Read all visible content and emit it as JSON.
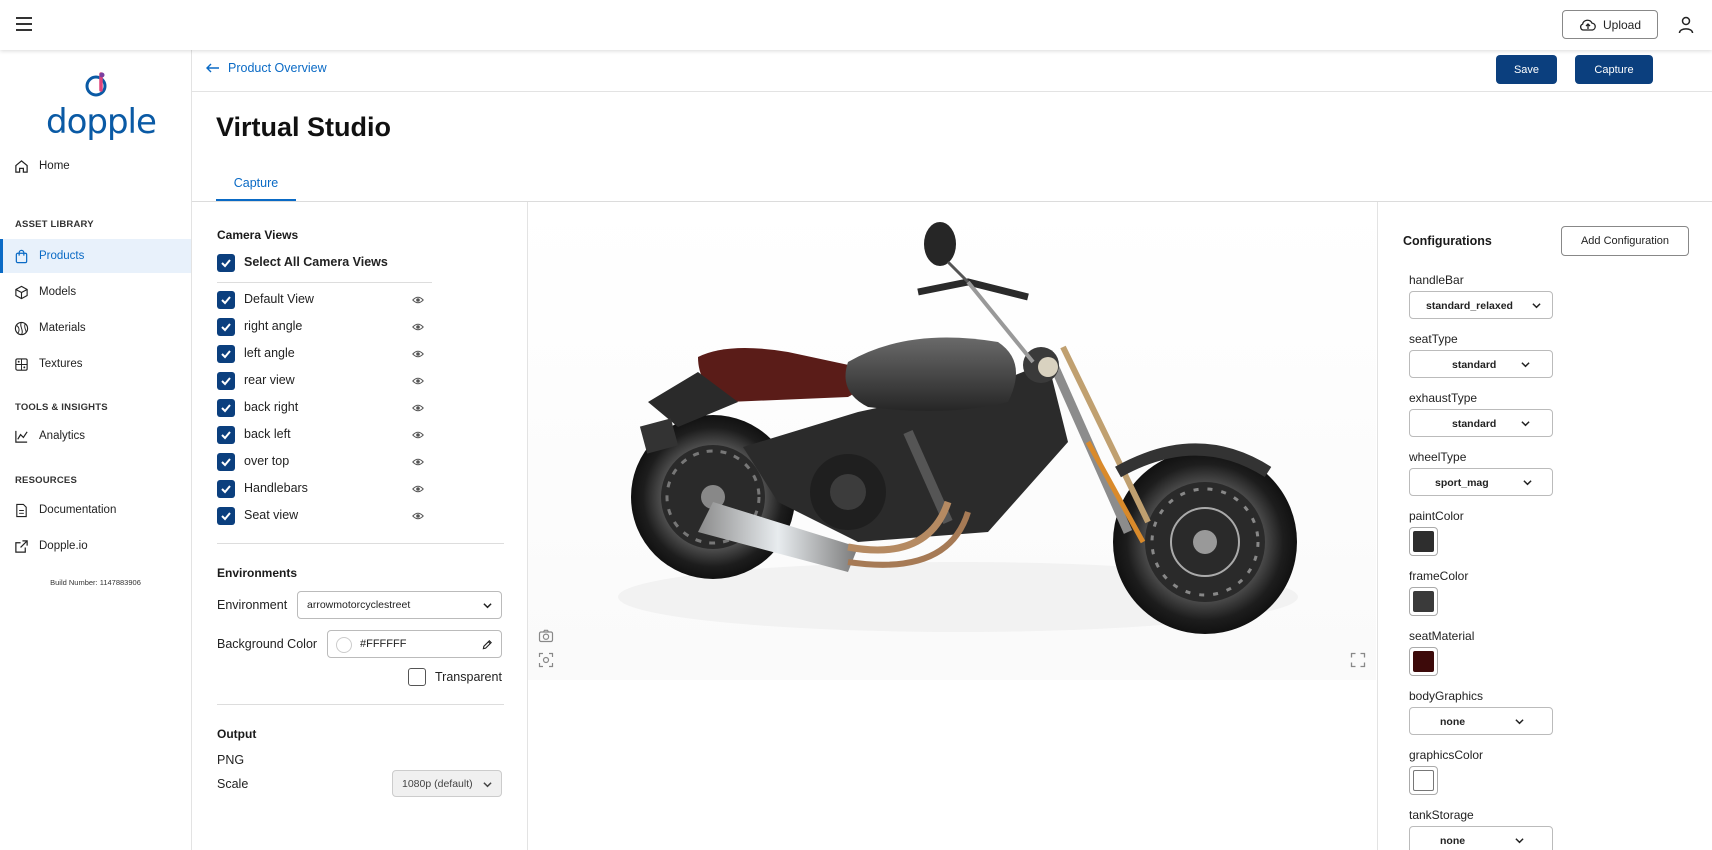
{
  "topbar": {
    "upload_label": "Upload"
  },
  "brand": {
    "logo_text": "dopple"
  },
  "sidebar": {
    "home": "Home",
    "section_asset_library": "ASSET LIBRARY",
    "products": "Products",
    "models": "Models",
    "materials": "Materials",
    "textures": "Textures",
    "section_tools": "TOOLS & INSIGHTS",
    "analytics": "Analytics",
    "section_resources": "RESOURCES",
    "documentation": "Documentation",
    "dopple_io": "Dopple.io",
    "build_number": "Build Number: 1147883906"
  },
  "header": {
    "back_label": "Product Overview",
    "save_label": "Save",
    "capture_label": "Capture",
    "page_title": "Virtual Studio",
    "tab_capture": "Capture"
  },
  "camera_views": {
    "title": "Camera Views",
    "select_all": "Select All Camera Views",
    "items": [
      {
        "label": "Default View",
        "checked": true
      },
      {
        "label": "right angle",
        "checked": true
      },
      {
        "label": "left angle",
        "checked": true
      },
      {
        "label": "rear view",
        "checked": true
      },
      {
        "label": "back right",
        "checked": true
      },
      {
        "label": "back left",
        "checked": true
      },
      {
        "label": "over top",
        "checked": true
      },
      {
        "label": "Handlebars",
        "checked": true
      },
      {
        "label": "Seat view",
        "checked": true
      }
    ]
  },
  "environments": {
    "title": "Environments",
    "environment_label": "Environment",
    "environment_value": "arrowmotorcyclestreet",
    "background_label": "Background Color",
    "background_value": "#FFFFFF",
    "transparent_label": "Transparent",
    "transparent_checked": false
  },
  "output": {
    "title": "Output",
    "format": "PNG",
    "scale_label": "Scale",
    "scale_value": "1080p (default)"
  },
  "configurations": {
    "title": "Configurations",
    "add_label": "Add Configuration",
    "options": [
      {
        "label": "handleBar",
        "type": "select",
        "value": "standard_relaxed"
      },
      {
        "label": "seatType",
        "type": "select",
        "value": "standard"
      },
      {
        "label": "exhaustType",
        "type": "select",
        "value": "standard"
      },
      {
        "label": "wheelType",
        "type": "select",
        "value": "sport_mag"
      },
      {
        "label": "paintColor",
        "type": "color",
        "color": "#2e2e2e"
      },
      {
        "label": "frameColor",
        "type": "color",
        "color": "#3a3a3a"
      },
      {
        "label": "seatMaterial",
        "type": "color",
        "color": "#3d0a0a"
      },
      {
        "label": "bodyGraphics",
        "type": "select",
        "value": "none"
      },
      {
        "label": "graphicsColor",
        "type": "color",
        "color": "#ffffff"
      },
      {
        "label": "tankStorage",
        "type": "select",
        "value": "none"
      }
    ]
  },
  "colors": {
    "primary": "#0b3f7e",
    "accent": "#0a6ac5"
  }
}
